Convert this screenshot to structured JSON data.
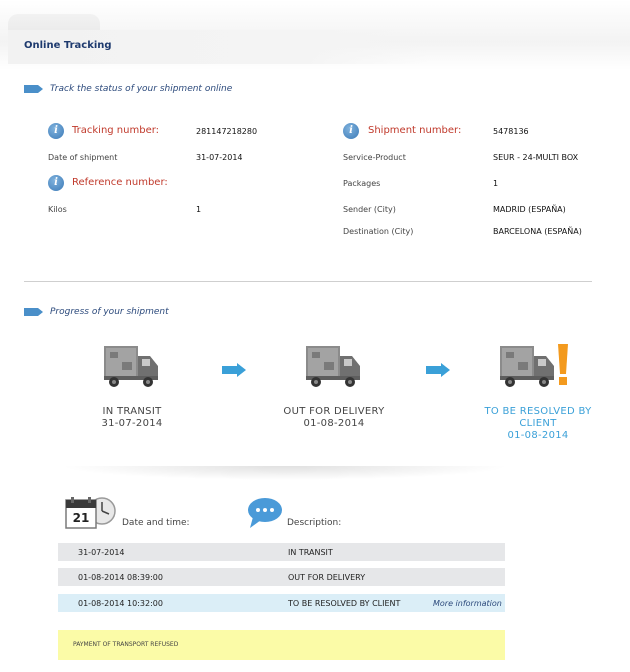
{
  "header": {
    "tab_title": "Online Tracking"
  },
  "status_section": {
    "title": "Track the status of your shipment online",
    "tracking_number_label": "Tracking number:",
    "tracking_number_value": "281147218280",
    "date_of_shipment_label": "Date of shipment",
    "date_of_shipment_value": "31-07-2014",
    "reference_number_label": "Reference number:",
    "kilos_label": "Kilos",
    "kilos_value": "1",
    "shipment_number_label": "Shipment number:",
    "shipment_number_value": "5478136",
    "service_product_label": "Service-Product",
    "service_product_value": "SEUR - 24-MULTI BOX",
    "packages_label": "Packages",
    "packages_value": "1",
    "sender_label": "Sender (City)",
    "sender_value": "MADRID (ESPAÑA)",
    "destination_label": "Destination (City)",
    "destination_value": "BARCELONA (ESPAÑA)"
  },
  "progress_section": {
    "title": "Progress of your shipment",
    "steps": [
      {
        "status": "IN TRANSIT",
        "date": "31-07-2014"
      },
      {
        "status": "OUT FOR DELIVERY",
        "date": "01-08-2014"
      },
      {
        "status_line1": "TO BE RESOLVED BY",
        "status_line2": "CLIENT",
        "date": "01-08-2014"
      }
    ]
  },
  "history": {
    "calendar_day": "21",
    "date_header": "Date and time:",
    "description_header": "Description:",
    "rows": [
      {
        "date": "31-07-2014",
        "description": "IN TRANSIT",
        "link": ""
      },
      {
        "date": "01-08-2014 08:39:00",
        "description": "OUT FOR DELIVERY",
        "link": ""
      },
      {
        "date": "01-08-2014 10:32:00",
        "description": "TO BE RESOLVED BY CLIENT",
        "link": "More information"
      }
    ],
    "note": "PAYMENT OF TRANSPORT REFUSED"
  },
  "colors": {
    "accent_blue": "#3aa0d8",
    "label_red": "#c0392b",
    "title_navy": "#1e3a6e",
    "warning_orange": "#f39a1e",
    "note_yellow": "#fbfba7"
  },
  "icons": [
    "info-icon",
    "section-arrow-icon",
    "truck-icon",
    "arrow-right-icon",
    "exclamation-icon",
    "calendar-clock-icon",
    "speech-bubble-icon"
  ]
}
